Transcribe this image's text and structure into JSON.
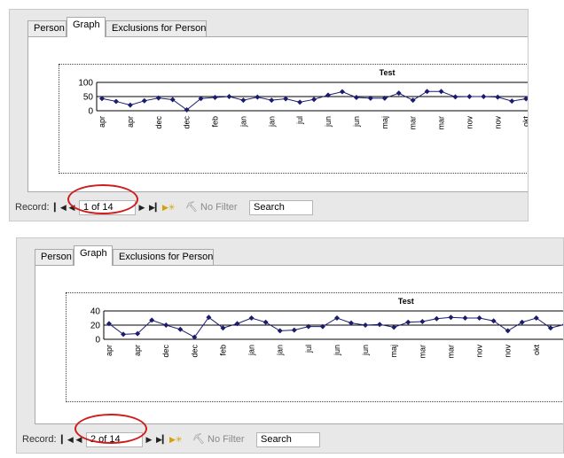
{
  "tabs": [
    {
      "label": "Person"
    },
    {
      "label": "Graph",
      "active": true
    },
    {
      "label": "Exclusions for  Person"
    }
  ],
  "navigation": {
    "record_label": "Record:",
    "no_filter_label": "No Filter",
    "search_label": "Search",
    "first_icon": "first-record-icon",
    "prev_icon": "previous-record-icon",
    "next_icon": "next-record-icon",
    "last_icon": "last-record-icon",
    "new_icon": "new-record-icon",
    "filter_icon": "no-filter-icon"
  },
  "colors": {
    "series": "#1c1c6e",
    "highlight_oval": "#d01c1c"
  },
  "views": [
    {
      "record_text": "1 of 14",
      "chart_data": {
        "type": "line",
        "title": "Test",
        "ylim": [
          0,
          100
        ],
        "yticks": [
          0,
          50,
          100
        ],
        "x": [
          "apr",
          "",
          "apr",
          "",
          "dec",
          "",
          "dec",
          "",
          "feb",
          "",
          "jan",
          "",
          "jan",
          "",
          "jul",
          "",
          "jun",
          "",
          "jun",
          "",
          "maj",
          "",
          "mar",
          "",
          "mar",
          "",
          "nov",
          "",
          "nov",
          "",
          "okt",
          ""
        ],
        "values": [
          43,
          33,
          20,
          35,
          45,
          39,
          3,
          43,
          47,
          50,
          37,
          48,
          37,
          42,
          30,
          40,
          55,
          67,
          47,
          44,
          44,
          62,
          37,
          68,
          68,
          49,
          50,
          50,
          48,
          34,
          42,
          45
        ]
      }
    },
    {
      "record_text": "2 of 14",
      "chart_data": {
        "type": "line",
        "title": "Test",
        "ylim": [
          0,
          40
        ],
        "yticks": [
          0,
          20,
          40
        ],
        "x": [
          "apr",
          "",
          "apr",
          "",
          "dec",
          "",
          "dec",
          "",
          "feb",
          "",
          "jan",
          "",
          "jan",
          "",
          "jul",
          "",
          "jun",
          "",
          "jun",
          "",
          "maj",
          "",
          "mar",
          "",
          "mar",
          "",
          "nov",
          "",
          "nov",
          "",
          "okt",
          ""
        ],
        "values": [
          22,
          7,
          8,
          27,
          20,
          14,
          3,
          31,
          16,
          22,
          30,
          24,
          12,
          13,
          18,
          18,
          30,
          23,
          20,
          21,
          17,
          24,
          25,
          29,
          31,
          30,
          30,
          26,
          12,
          24,
          30,
          16,
          21
        ]
      }
    }
  ]
}
